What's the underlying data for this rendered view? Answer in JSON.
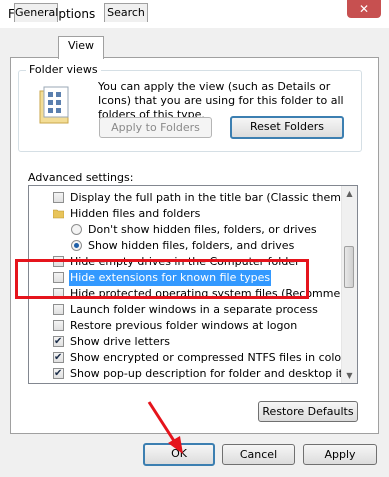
{
  "window": {
    "title": "Folder Options",
    "close_label": "✕"
  },
  "tabs": [
    {
      "label": "General"
    },
    {
      "label": "View"
    },
    {
      "label": "Search"
    }
  ],
  "folder_views": {
    "label": "Folder views",
    "description": "You can apply the view (such as Details or Icons) that you are using for this folder to all folders of this type.",
    "apply_label": "Apply to Folders",
    "reset_label": "Reset Folders"
  },
  "advanced": {
    "label": "Advanced settings:",
    "items": [
      {
        "text": "Display the full path in the title bar (Classic theme only)",
        "kind": "checkbox",
        "checked": false,
        "indent": 1
      },
      {
        "text": "Hidden files and folders",
        "kind": "folder",
        "checked": false,
        "indent": 1
      },
      {
        "text": "Don't show hidden files, folders, or drives",
        "kind": "radio",
        "checked": false,
        "indent": 2
      },
      {
        "text": "Show hidden files, folders, and drives",
        "kind": "radio",
        "checked": true,
        "indent": 2
      },
      {
        "text": "Hide empty drives in the Computer folder",
        "kind": "checkbox",
        "checked": false,
        "indent": 1
      },
      {
        "text": "Hide extensions for known file types",
        "kind": "checkbox",
        "checked": false,
        "indent": 1,
        "selected": true
      },
      {
        "text": "Hide protected operating system files (Recommended)",
        "kind": "checkbox",
        "checked": false,
        "indent": 1
      },
      {
        "text": "Launch folder windows in a separate process",
        "kind": "checkbox",
        "checked": false,
        "indent": 1
      },
      {
        "text": "Restore previous folder windows at logon",
        "kind": "checkbox",
        "checked": false,
        "indent": 1
      },
      {
        "text": "Show drive letters",
        "kind": "checkbox",
        "checked": true,
        "indent": 1
      },
      {
        "text": "Show encrypted or compressed NTFS files in color",
        "kind": "checkbox",
        "checked": true,
        "indent": 1
      },
      {
        "text": "Show pop-up description for folder and desktop items",
        "kind": "checkbox",
        "checked": true,
        "indent": 1
      }
    ],
    "restore_label": "Restore Defaults"
  },
  "footer": {
    "ok_label": "OK",
    "cancel_label": "Cancel",
    "apply_label": "Apply"
  },
  "colors": {
    "annotation": "#e5141c",
    "selection": "#3399ff"
  }
}
